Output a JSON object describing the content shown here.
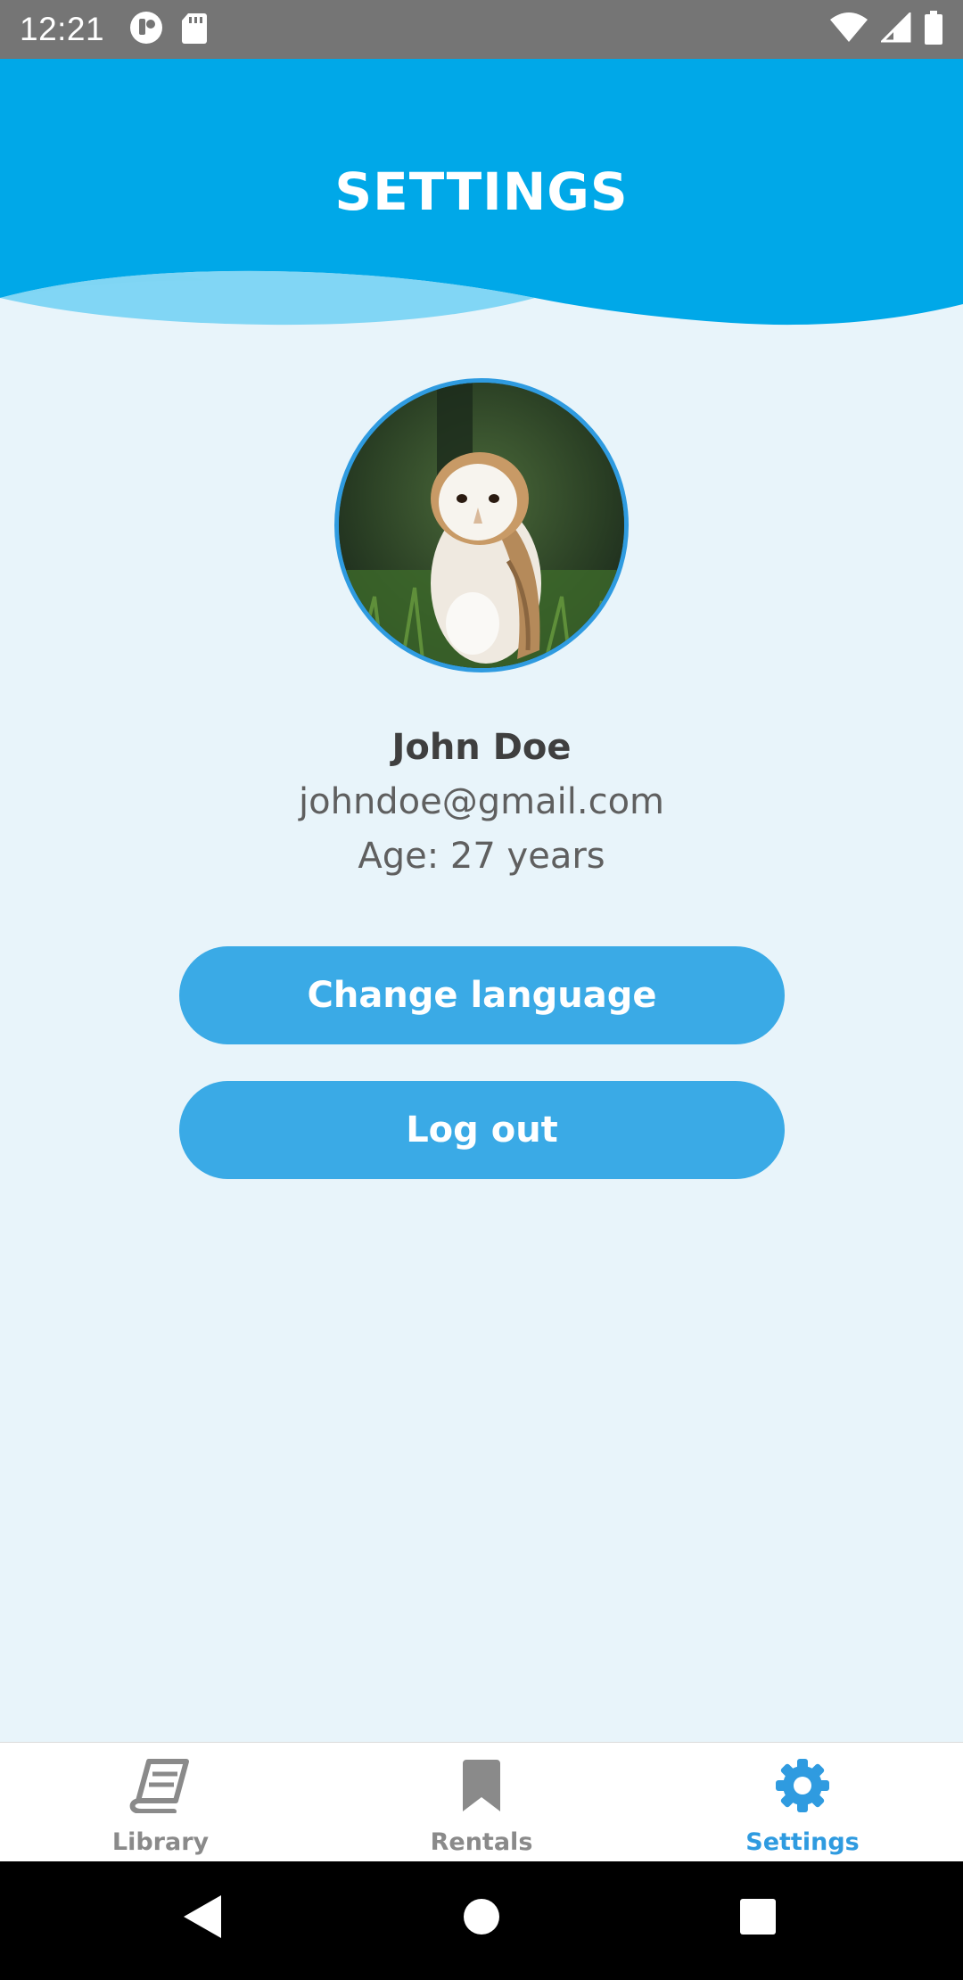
{
  "status_bar": {
    "time": "12:21",
    "icons": [
      "notification-app-icon",
      "sd-card-icon",
      "wifi-icon",
      "signal-icon",
      "battery-icon"
    ]
  },
  "header": {
    "title": "SETTINGS",
    "color": "#00a8e8"
  },
  "profile": {
    "name": "John Doe",
    "email": "johndoe@gmail.com",
    "age": "Age: 27 years",
    "avatar_subject": "owl-photo"
  },
  "actions": {
    "change_language": "Change language",
    "logout": "Log out",
    "button_color": "#3aaae6"
  },
  "bottom_nav": {
    "items": [
      {
        "label": "Library",
        "icon": "book-icon",
        "active": false
      },
      {
        "label": "Rentals",
        "icon": "bookmark-icon",
        "active": false
      },
      {
        "label": "Settings",
        "icon": "gear-icon",
        "active": true
      }
    ],
    "active_color": "#2f9be0",
    "inactive_color": "#8a8a8a"
  },
  "system_nav": {
    "icons": [
      "back-icon",
      "home-icon",
      "recents-icon"
    ]
  }
}
